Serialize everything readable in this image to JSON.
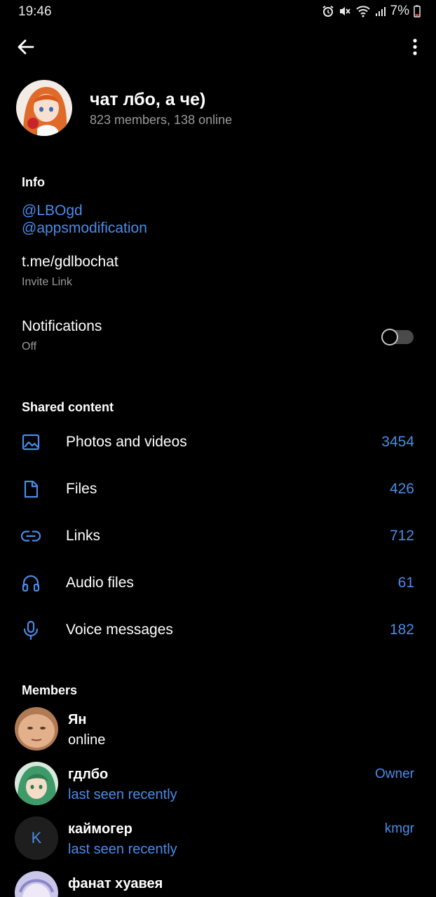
{
  "status_bar": {
    "time": "19:46",
    "battery": "7%",
    "icons": [
      "alarm-icon",
      "mute-icon",
      "wifi-icon",
      "signal-icon",
      "battery-icon"
    ]
  },
  "toolbar": {
    "back_icon": "arrow-left-icon",
    "more_icon": "more-vertical-icon"
  },
  "group": {
    "title": "чат лбо, а че)",
    "subtitle": "823 members, 138 online"
  },
  "info": {
    "title": "Info",
    "usernames": [
      "@LBOgd",
      "@appsmodification"
    ],
    "invite_link": "t.me/gdlbochat",
    "invite_label": "Invite Link"
  },
  "notifications": {
    "label": "Notifications",
    "value": "Off",
    "enabled": false
  },
  "shared": {
    "title": "Shared content",
    "items": [
      {
        "label": "Photos and videos",
        "count": "3454",
        "icon": "image-icon"
      },
      {
        "label": "Files",
        "count": "426",
        "icon": "file-icon"
      },
      {
        "label": "Links",
        "count": "712",
        "icon": "link-icon"
      },
      {
        "label": "Audio files",
        "count": "61",
        "icon": "headphones-icon"
      },
      {
        "label": "Voice messages",
        "count": "182",
        "icon": "microphone-icon"
      }
    ]
  },
  "members": {
    "title": "Members",
    "list": [
      {
        "name": "Ян",
        "status": "online",
        "role": ""
      },
      {
        "name": "гдлбо",
        "status": "last seen recently",
        "role": "Owner"
      },
      {
        "name": "каймогер",
        "status": "last seen recently",
        "role": "kmgr",
        "initial": "K"
      },
      {
        "name": "фанат хуавея",
        "status": "",
        "role": ""
      }
    ]
  },
  "colors": {
    "background": "#000000",
    "accent": "#4a8be8",
    "secondary_text": "#9a9a9a"
  }
}
